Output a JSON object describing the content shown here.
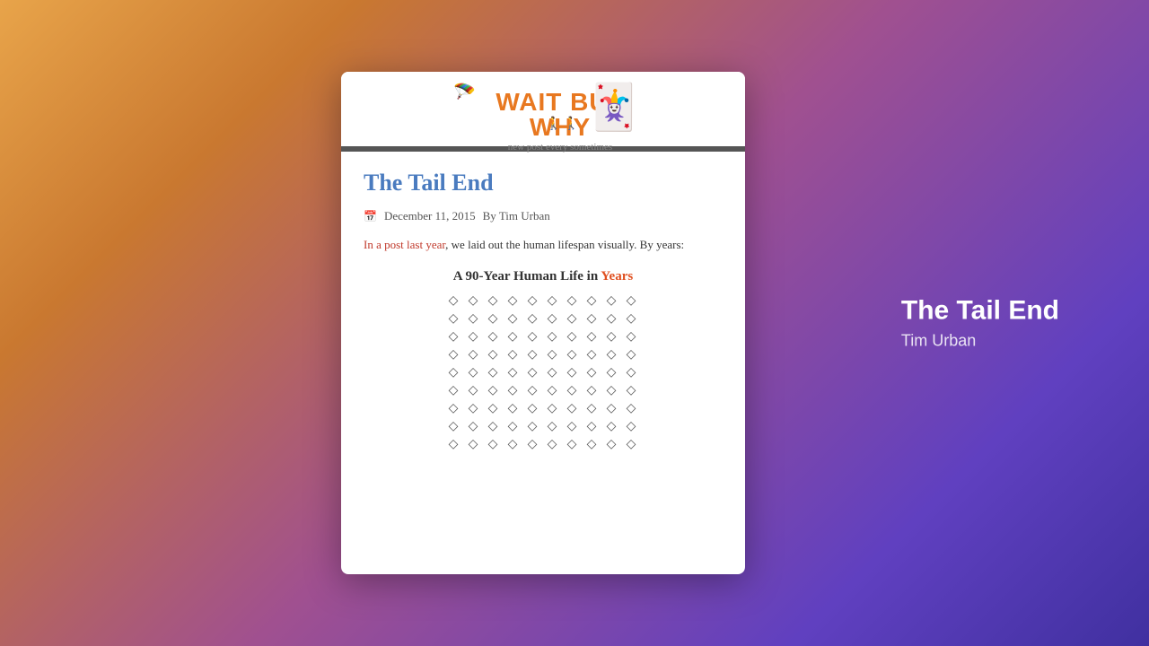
{
  "background": {
    "gradient_start": "#e8a44a",
    "gradient_mid": "#a05090",
    "gradient_end": "#4030a0"
  },
  "overlay": {
    "title": "The Tail End",
    "author": "Tim Urban"
  },
  "site": {
    "name": "WAIT BUT WHY",
    "tagline": "new post every sometimes"
  },
  "article": {
    "title": "The Tail End",
    "date": "December 11, 2015",
    "author": "By Tim Urban",
    "intro_link": "In a post last year",
    "intro_rest": ", we laid out the human lifespan visually. By years:",
    "chart_title_part1": "A 90-Year Human Life in ",
    "chart_title_years": "Years"
  },
  "icons": {
    "calendar": "📅",
    "diamond": "◇"
  }
}
